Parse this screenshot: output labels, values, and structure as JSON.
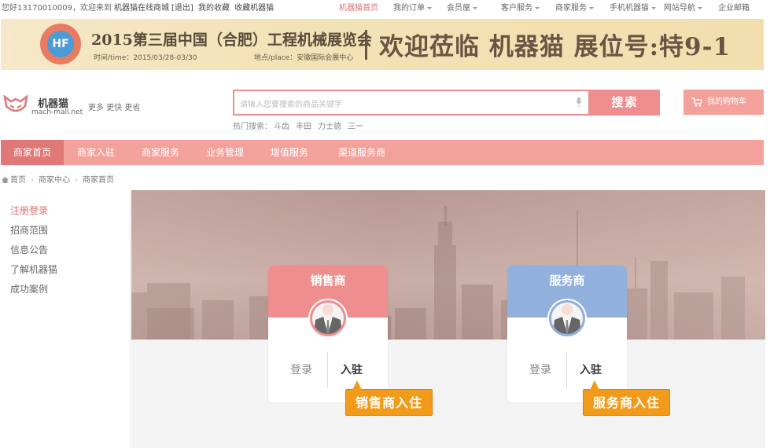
{
  "topbar": {
    "greeting": "您好13170010009，欢迎来到",
    "site_link": "机器猫在线商城",
    "logout": "[退出]",
    "my_favorites": "我的收藏",
    "bookmark": "收藏机器猫",
    "nav": [
      {
        "label": "机器猫首页",
        "active": true,
        "dropdown": false
      },
      {
        "label": "我的订单",
        "dropdown": true
      },
      {
        "label": "会员屋",
        "dropdown": true
      },
      {
        "label": "客户服务",
        "dropdown": true
      },
      {
        "label": "商家服务",
        "dropdown": true
      },
      {
        "label": "手机机器猫",
        "dropdown": true
      },
      {
        "label": "网站导航",
        "dropdown": true
      },
      {
        "label": "企业邮箱",
        "dropdown": false
      }
    ]
  },
  "banner": {
    "logo_text": "HF",
    "title": "2015第三届中国（合肥）工程机械展览会",
    "time": "时间/time：2015/03/28-03/30",
    "place": "地点/place：安徽国际会展中心",
    "welcome": "欢迎莅临 机器猫 展位号:特9-1"
  },
  "brand": {
    "name": "机器猫",
    "domain": "mach-mall.net",
    "slogan": "更多 更快 更省"
  },
  "search": {
    "placeholder": "请输入您要搜索的商品关键字",
    "button": "搜索",
    "hot_label": "热门搜索：",
    "hot_terms": [
      "斗齿",
      "丰田",
      "力士德",
      "三一"
    ]
  },
  "cart": {
    "label": "我的购物车"
  },
  "main_nav": [
    "商家首页",
    "商家入驻",
    "商家服务",
    "业务管理",
    "增值服务",
    "渠道服务商"
  ],
  "breadcrumb": [
    "首页",
    "商家中心",
    "商家首页"
  ],
  "sidebar": [
    "注册登录",
    "招商范围",
    "信息公告",
    "了解机器猫",
    "成功案例"
  ],
  "cards": [
    {
      "title": "销售商",
      "login": "登录",
      "join": "入驻",
      "tip": "销售商入住",
      "color": "#ef8e8e"
    },
    {
      "title": "服务商",
      "login": "登录",
      "join": "入驻",
      "tip": "服务商入住",
      "color": "#92b0dc"
    }
  ],
  "colors": {
    "accent": "#ef8e8e",
    "nav_bg": "#f2a19b",
    "nav_active": "#e07878",
    "tip": "#f29a1a"
  }
}
